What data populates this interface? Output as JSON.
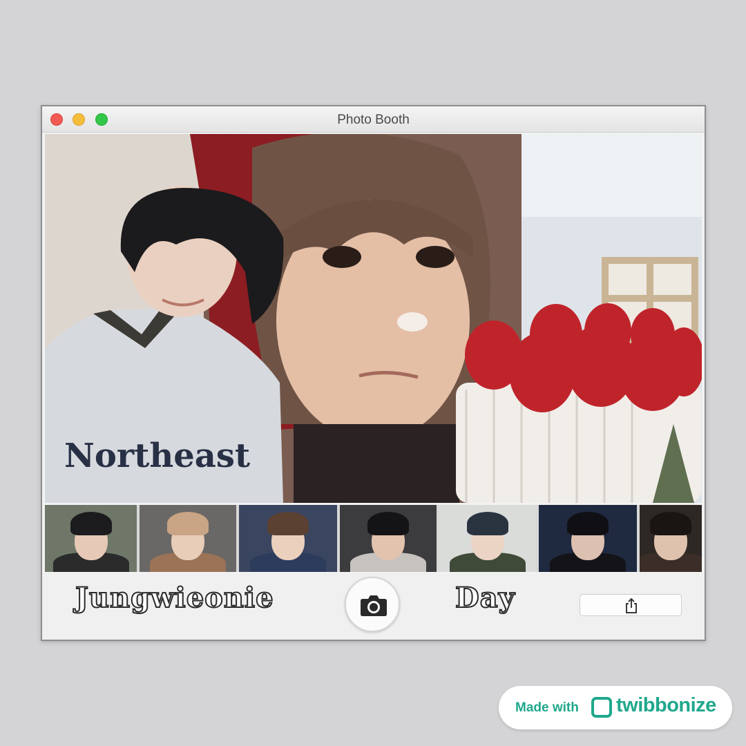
{
  "window": {
    "title": "Photo Booth"
  },
  "preview": {
    "sweater_text": "Northeast"
  },
  "thumbnails": [
    {
      "bg": "#6f7868",
      "hair": "#1c1c1e",
      "skin": "#e6c9b6",
      "cloth": "#2b2b2b"
    },
    {
      "bg": "#6a6866",
      "hair": "#c9a585",
      "skin": "#e8cdb9",
      "cloth": "#9b7357"
    },
    {
      "bg": "#3a4660",
      "hair": "#5b4132",
      "skin": "#ebd0bd",
      "cloth": "#2d3b5c"
    },
    {
      "bg": "#3c3c3e",
      "hair": "#141416",
      "skin": "#e2c3ae",
      "cloth": "#c6c3bf"
    },
    {
      "bg": "#d9dcd9",
      "hair": "#2a3340",
      "skin": "#ebd4c4",
      "cloth": "#3f4a38"
    },
    {
      "bg": "#1f2a40",
      "hair": "#101014",
      "skin": "#dcc0b0",
      "cloth": "#141418"
    },
    {
      "bg": "#2d2824",
      "hair": "#1a1412",
      "skin": "#dec2ae",
      "cloth": "#3b2e28"
    }
  ],
  "bottom": {
    "caption_left": "Jungwieonie",
    "caption_right": "Day"
  },
  "badge": {
    "made_with": "Made with",
    "brand": "twibbonize"
  },
  "colors": {
    "brand": "#1fa88c",
    "close": "#f05a52",
    "minimize": "#f5bd3c",
    "zoom": "#32c749"
  }
}
